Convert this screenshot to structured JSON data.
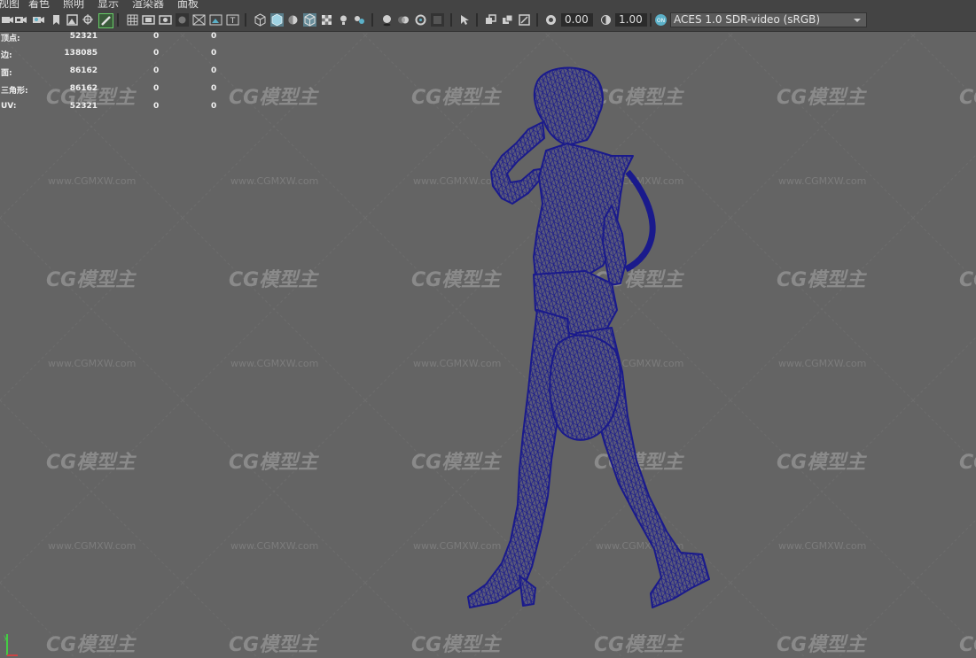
{
  "menu": {
    "items": [
      "视图",
      "着色",
      "照明",
      "显示",
      "渲染器",
      "面板"
    ]
  },
  "toolbar": {
    "field_a_value": "0.00",
    "field_b_value": "1.00",
    "color_management": "ACES 1.0 SDR-video (sRGB)",
    "icons": [
      "camera-select-icon",
      "camera-attributes-icon",
      "bookmark-icon",
      "image-plane-icon",
      "pan-zoom-icon",
      "grease-pencil-icon",
      "grid-icon",
      "film-gate-icon",
      "resolution-gate-icon",
      "gate-mask-icon",
      "field-chart-icon",
      "safe-action-icon",
      "safe-title-icon",
      "wireframe-icon",
      "smooth-shade-icon",
      "default-material-icon",
      "wireframe-on-shaded-icon",
      "xray-icon",
      "textured-icon",
      "lights-icon",
      "shadows-icon",
      "ambient-occlusion-icon",
      "motion-blur-icon",
      "antialiasing-icon",
      "depth-of-field-icon",
      "isolate-select-icon",
      "xray-joints-icon",
      "backface-culling-icon",
      "exposure-icon",
      "gamma-icon",
      "color-management-icon"
    ]
  },
  "hud": {
    "rows": [
      {
        "label": "顶点:",
        "v1": "52321",
        "v2": "0",
        "v3": "0"
      },
      {
        "label": "边:",
        "v1": "138085",
        "v2": "0",
        "v3": "0"
      },
      {
        "label": "面:",
        "v1": "86162",
        "v2": "0",
        "v3": "0"
      },
      {
        "label": "三角形:",
        "v1": "86162",
        "v2": "0",
        "v3": "0"
      },
      {
        "label": "UV:",
        "v1": "52321",
        "v2": "0",
        "v3": "0"
      }
    ]
  },
  "watermark": {
    "logo_text": "CG模型主",
    "url_text": "www.CGMXW.com"
  },
  "colors": {
    "viewport_bg": "#646464",
    "panel_bg": "#444444",
    "wireframe": "#1a1a8c",
    "accent": "#5bb0c8"
  }
}
